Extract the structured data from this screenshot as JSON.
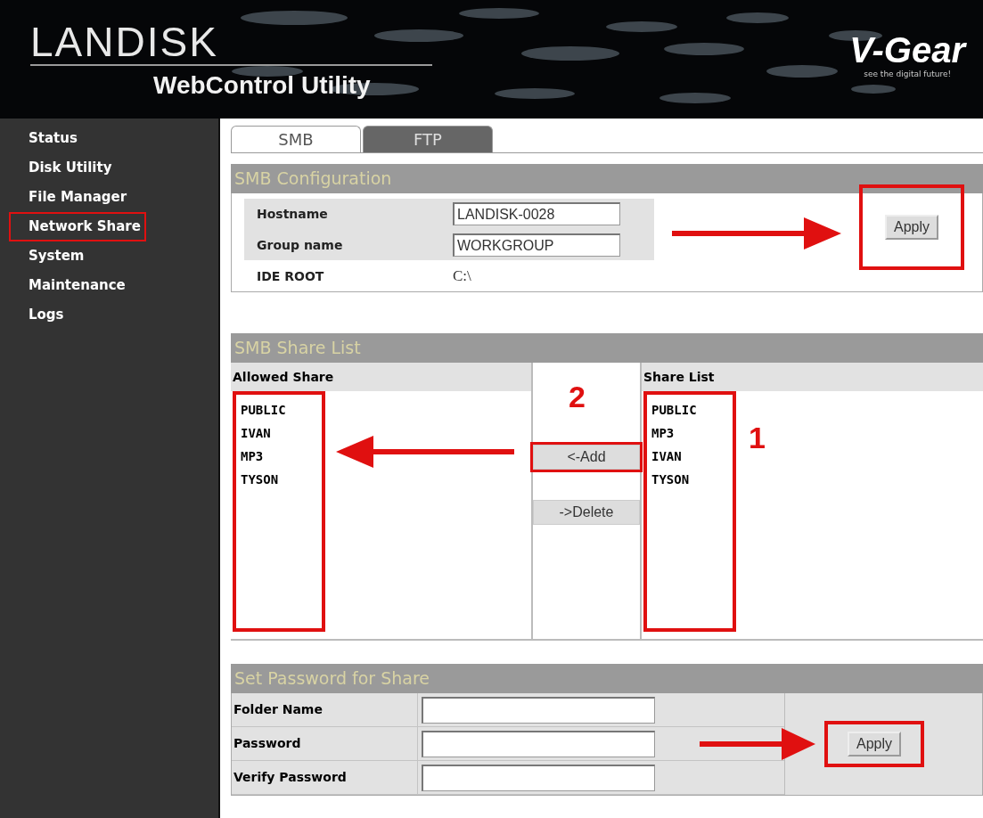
{
  "header": {
    "product": "LANDISK",
    "subtitle": "WebControl Utility",
    "brand": "V-Gear",
    "tagline": "see the digital future!"
  },
  "sidebar": {
    "items": [
      {
        "label": "Status",
        "highlighted": false
      },
      {
        "label": "Disk Utility",
        "highlighted": false
      },
      {
        "label": "File Manager",
        "highlighted": false
      },
      {
        "label": "Network Share",
        "highlighted": true
      },
      {
        "label": "System",
        "highlighted": false
      },
      {
        "label": "Maintenance",
        "highlighted": false
      },
      {
        "label": "Logs",
        "highlighted": false
      }
    ]
  },
  "tabs": [
    {
      "label": "SMB",
      "selected": true
    },
    {
      "label": "FTP",
      "selected": false
    }
  ],
  "smb_configuration": {
    "title": "SMB Configuration",
    "fields": [
      {
        "label": "Hostname",
        "kind": "input",
        "value": "LANDISK-0028"
      },
      {
        "label": "Group name",
        "kind": "input",
        "value": "WORKGROUP"
      },
      {
        "label": "IDE ROOT",
        "kind": "text",
        "value": "C:\\"
      }
    ],
    "apply_button": {
      "label": "Apply",
      "highlighted": true
    }
  },
  "smb_share_list": {
    "title": "SMB Share List",
    "allowed_share": {
      "heading": "Allowed Share",
      "items": [
        "PUBLIC",
        "IVAN",
        "MP3",
        "TYSON"
      ],
      "highlighted": true
    },
    "add_button": {
      "label": "<-Add",
      "highlighted": true,
      "callout": "2"
    },
    "delete_button": {
      "label": "->Delete",
      "highlighted": false
    },
    "share_list": {
      "heading": "Share List",
      "items": [
        "PUBLIC",
        "MP3",
        "IVAN",
        "TYSON"
      ],
      "highlighted": true,
      "callout": "1"
    }
  },
  "set_password": {
    "title": "Set Password for Share",
    "fields": [
      {
        "label": "Folder Name"
      },
      {
        "label": "Password"
      },
      {
        "label": "Verify Password"
      }
    ],
    "apply_button": {
      "label": "Apply",
      "highlighted": true
    }
  }
}
